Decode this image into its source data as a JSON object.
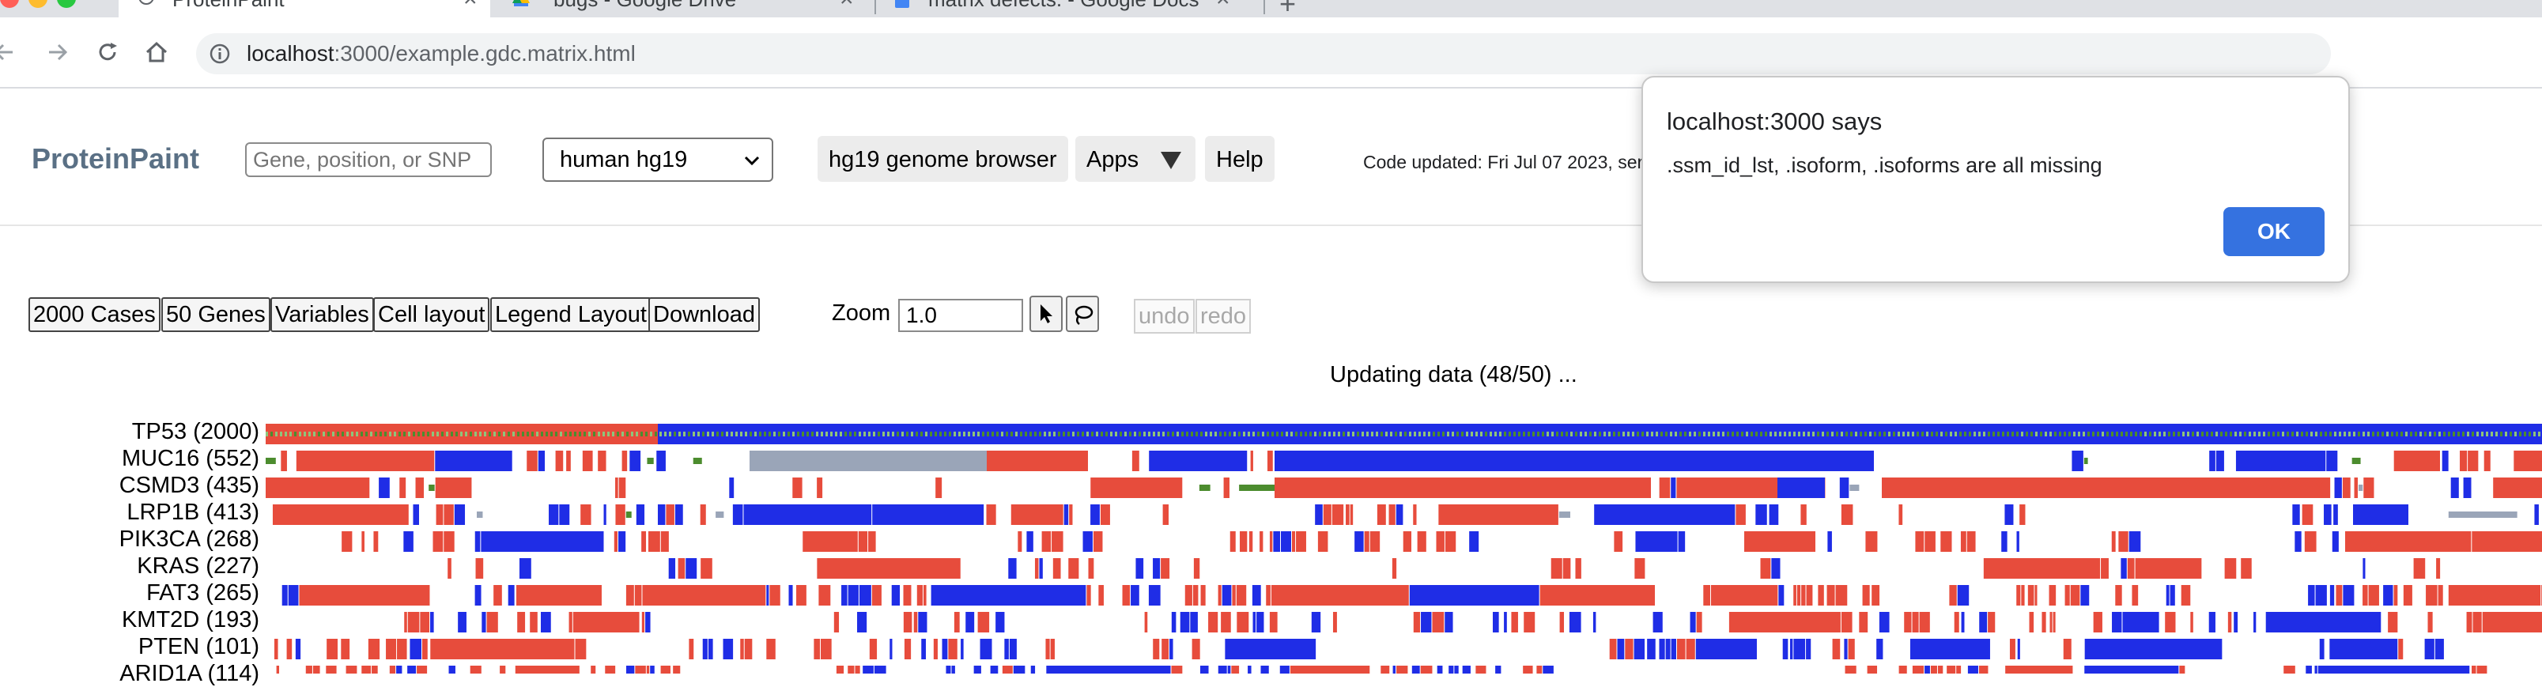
{
  "browser": {
    "tabs": [
      {
        "title": "ProteinPaint",
        "active": true
      },
      {
        "title": "bugs - Google Drive",
        "active": false
      },
      {
        "title": "matrix defects. - Google Docs",
        "active": false
      }
    ],
    "url_host": "localhost",
    "url_rest": ":3000/example.gdc.matrix.html",
    "icons": {
      "back": "arrow-left-icon",
      "forward": "arrow-right-icon",
      "reload": "reload-icon",
      "home": "home-icon",
      "site_info": "info-icon",
      "new_tab": "plus-icon"
    }
  },
  "header": {
    "brand": "ProteinPaint",
    "search_placeholder": "Gene, position, or SNP",
    "genome": "human hg19",
    "genome_browser_label": "hg19 genome browser",
    "apps_label": "Apps",
    "help_label": "Help",
    "code_updated": "Code updated: Fri Jul 07 2023, ser"
  },
  "controls": {
    "cases": "2000 Cases",
    "genes": "50 Genes",
    "variables": "Variables",
    "cell_layout": "Cell layout",
    "legend_layout": "Legend Layout",
    "download": "Download",
    "zoom_label": "Zoom",
    "zoom_value": "1.0",
    "undo": "undo",
    "redo": "redo"
  },
  "status": "Updating data (48/50) ...",
  "matrix": {
    "rows": [
      {
        "label": "TP53 (2000)"
      },
      {
        "label": "MUC16 (552)"
      },
      {
        "label": "CSMD3 (435)"
      },
      {
        "label": "LRP1B (413)"
      },
      {
        "label": "PIK3CA (268)"
      },
      {
        "label": "KRAS (227)"
      },
      {
        "label": "FAT3 (265)"
      },
      {
        "label": "KMT2D (193)"
      },
      {
        "label": "PTEN (101)"
      },
      {
        "label": "ARID1A (114)"
      }
    ],
    "colors": {
      "red": "#e74c3c",
      "blue": "#1f2de6",
      "green": "#4c8c2e",
      "lightgreen": "#8fc47a",
      "gray": "#9aa5b8",
      "white": "#ffffff"
    }
  },
  "alert": {
    "title": "localhost:3000 says",
    "message": ".ssm_id_lst, .isoform, .isoforms are all missing",
    "ok_label": "OK"
  }
}
